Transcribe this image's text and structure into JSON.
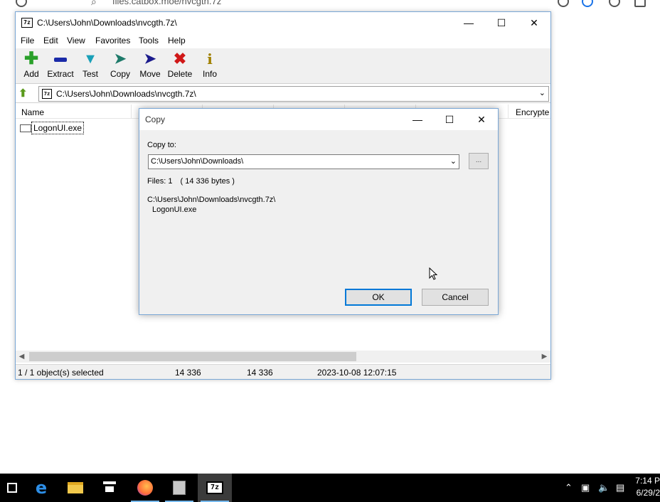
{
  "browser": {
    "url_text": "files.catbox.moe/nvcgth.7z"
  },
  "main_window": {
    "title": "C:\\Users\\John\\Downloads\\nvcgth.7z\\",
    "app_icon_text": "7z",
    "menu": [
      "File",
      "Edit",
      "View",
      "Favorites",
      "Tools",
      "Help"
    ],
    "toolbar": [
      {
        "label": "Add",
        "icon": "plus-icon",
        "color": "#2aa02a"
      },
      {
        "label": "Extract",
        "icon": "minus-icon",
        "color": "#1a2aa8"
      },
      {
        "label": "Test",
        "icon": "check-chevron-icon",
        "color": "#1aa0b8"
      },
      {
        "label": "Copy",
        "icon": "double-arrow-icon",
        "color": "#1e7a6a"
      },
      {
        "label": "Move",
        "icon": "arrow-right-icon",
        "color": "#1a1a8c"
      },
      {
        "label": "Delete",
        "icon": "x-icon",
        "color": "#d01818"
      },
      {
        "label": "Info",
        "icon": "info-icon",
        "color": "#a08000"
      }
    ],
    "address": "C:\\Users\\John\\Downloads\\nvcgth.7z\\",
    "columns": {
      "name": "Name",
      "encrypted": "Encrypte"
    },
    "files": [
      {
        "name": "LogonUI.exe"
      }
    ],
    "status": {
      "selected": "1 / 1 object(s) selected",
      "size": "14 336",
      "packed": "14 336",
      "modified": "2023-10-08 12:07:15"
    }
  },
  "copy_dialog": {
    "title": "Copy",
    "copy_to_label": "Copy to:",
    "destination": "C:\\Users\\John\\Downloads\\",
    "browse_label": "...",
    "files_count": "Files: 1",
    "files_bytes": "( 14 336 bytes )",
    "source_path": "C:\\Users\\John\\Downloads\\nvcgth.7z\\",
    "source_file": "LogonUI.exe",
    "ok_label": "OK",
    "cancel_label": "Cancel"
  },
  "taskbar": {
    "apps": [
      {
        "name": "edge",
        "icon": "edge-icon"
      },
      {
        "name": "file-explorer",
        "icon": "folder-icon"
      },
      {
        "name": "store",
        "icon": "store-icon"
      },
      {
        "name": "firefox",
        "icon": "firefox-icon"
      },
      {
        "name": "installer",
        "icon": "installer-icon"
      },
      {
        "name": "7zip",
        "icon": "7zip-icon",
        "label": "7z"
      }
    ],
    "clock_time": "7:14 P",
    "clock_date": "6/29/2"
  }
}
